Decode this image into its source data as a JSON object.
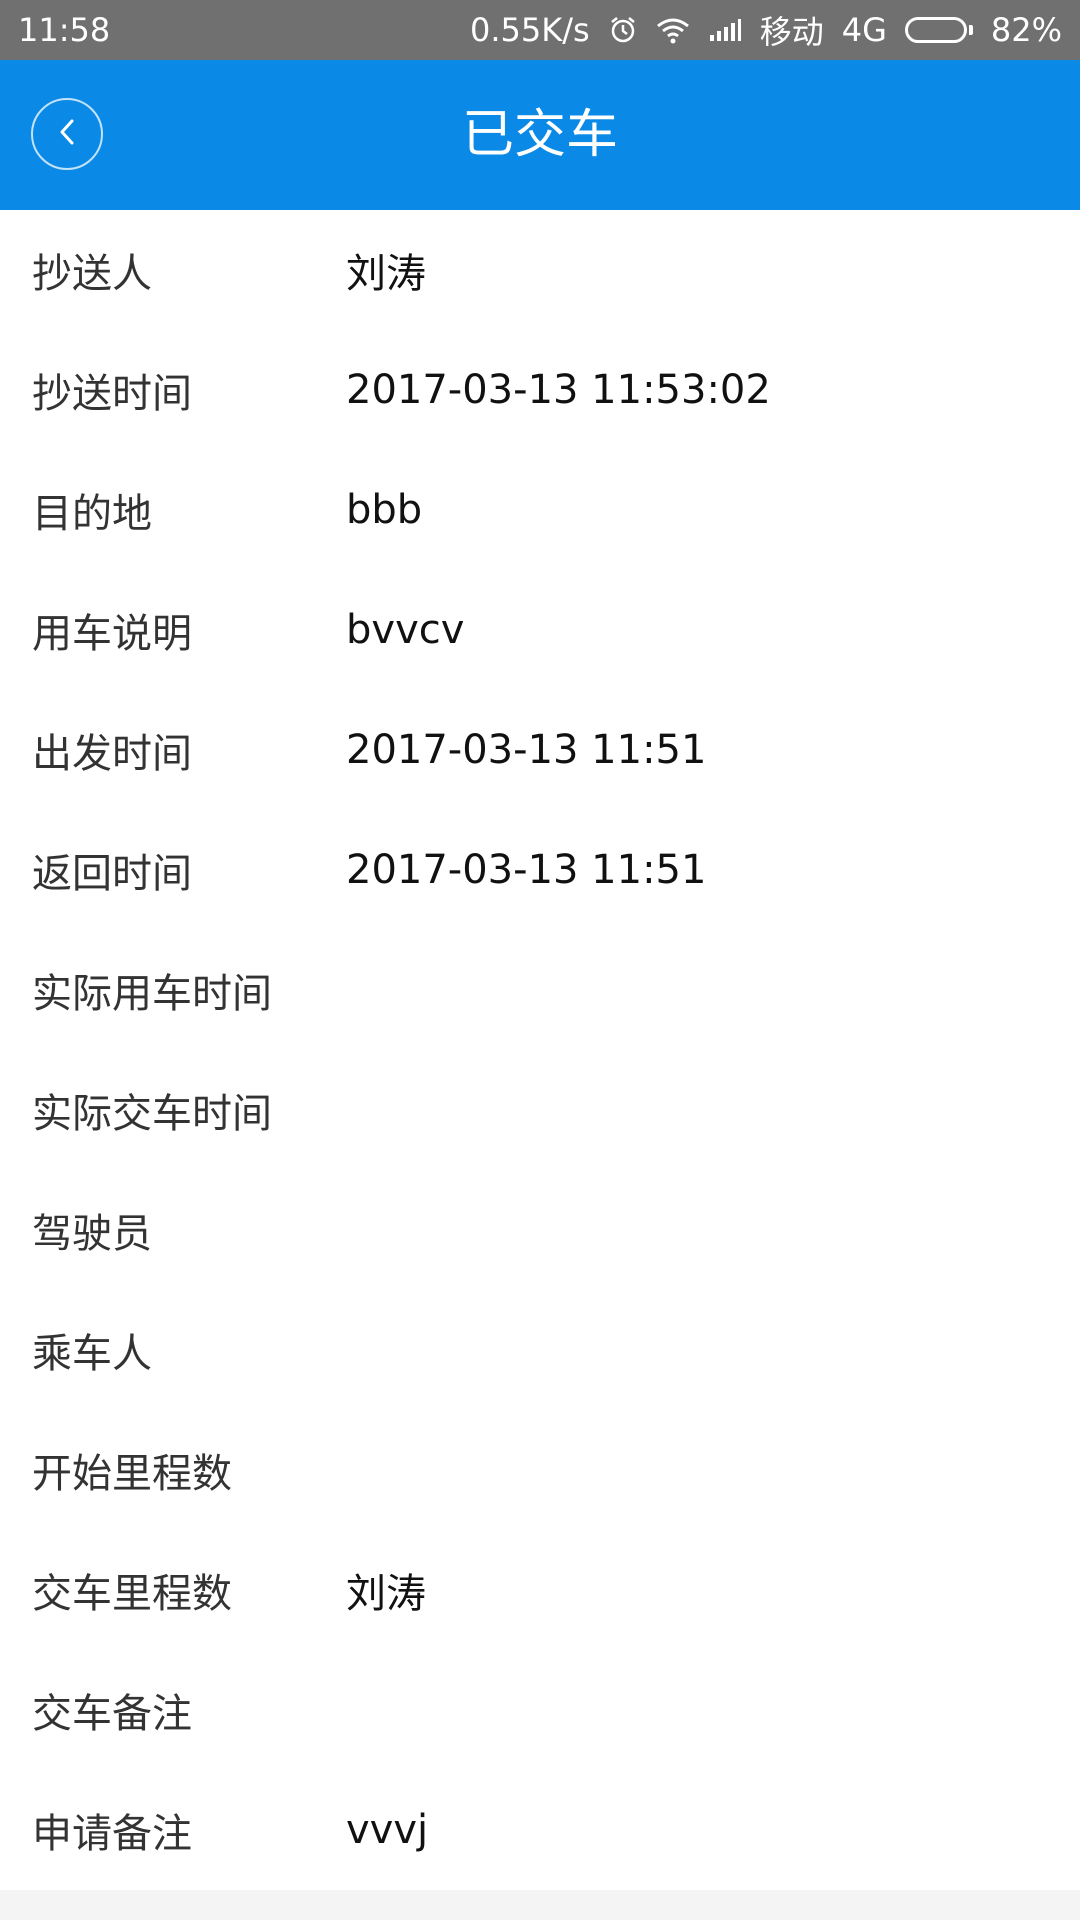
{
  "status_bar": {
    "time": "11:58",
    "net_speed": "0.55K/s",
    "carrier": "移动",
    "network": "4G",
    "battery_text": "82%",
    "battery_level": 0.82,
    "icons": [
      "alarm-icon",
      "wifi-icon",
      "signal-icon",
      "battery-icon"
    ]
  },
  "header": {
    "title": "已交车",
    "back_icon": "back-chevron-icon",
    "background": "#0a8ae6"
  },
  "fields": [
    {
      "label": "抄送人",
      "value": "刘涛"
    },
    {
      "label": "抄送时间",
      "value": "2017-03-13 11:53:02"
    },
    {
      "label": "目的地",
      "value": "bbb"
    },
    {
      "label": "用车说明",
      "value": "bvvcv"
    },
    {
      "label": "出发时间",
      "value": "2017-03-13 11:51"
    },
    {
      "label": "返回时间",
      "value": "2017-03-13 11:51"
    },
    {
      "label": "实际用车时间",
      "value": ""
    },
    {
      "label": "实际交车时间",
      "value": ""
    },
    {
      "label": "驾驶员",
      "value": ""
    },
    {
      "label": "乘车人",
      "value": ""
    },
    {
      "label": "开始里程数",
      "value": ""
    },
    {
      "label": "交车里程数",
      "value": "刘涛"
    },
    {
      "label": "交车备注",
      "value": ""
    },
    {
      "label": "申请备注",
      "value": "vvvj"
    }
  ]
}
